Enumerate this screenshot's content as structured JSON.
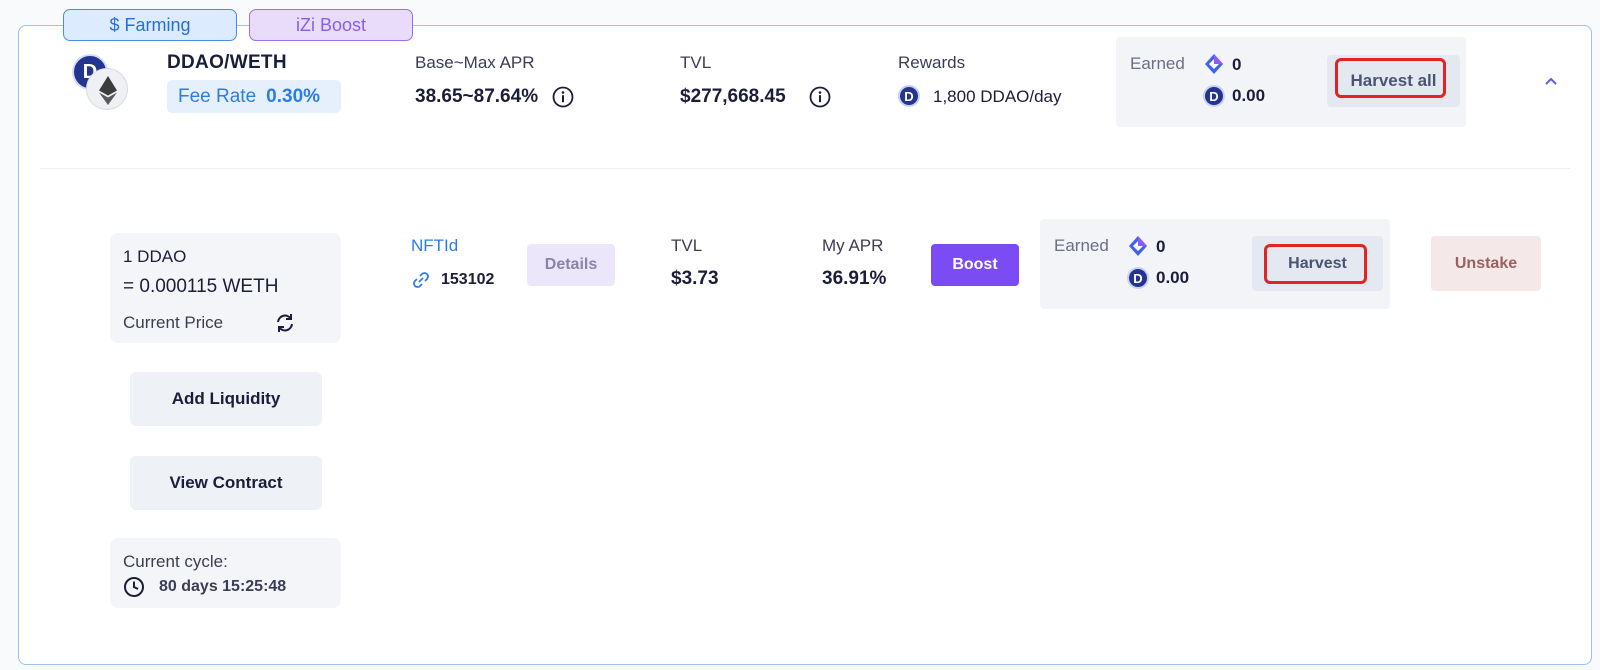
{
  "tags": {
    "farming": "$ Farming",
    "boost": "iZi Boost"
  },
  "pool": {
    "pair": "DDAO/WETH",
    "fee_rate_label": "Fee Rate",
    "fee_rate_value": "0.30%",
    "apr_label": "Base~Max APR",
    "apr_value": "38.65~87.64%",
    "tvl_label": "TVL",
    "tvl_value": "$277,668.45",
    "rewards_label": "Rewards",
    "rewards_value": "1,800 DDAO/day",
    "earned_label": "Earned",
    "earned_izi": "0",
    "earned_ddao": "0.00",
    "harvest_all_label": "Harvest all"
  },
  "sidebar": {
    "price_line1": "1 DDAO",
    "price_line2": "= 0.000115 WETH",
    "price_caption": "Current Price",
    "add_liquidity_label": "Add Liquidity",
    "view_contract_label": "View Contract",
    "cycle_label": "Current cycle:",
    "cycle_value": "80 days 15:25:48"
  },
  "position": {
    "nft_label": "NFTId",
    "nft_id": "153102",
    "details_label": "Details",
    "tvl_label": "TVL",
    "tvl_value": "$3.73",
    "my_apr_label": "My APR",
    "my_apr_value": "36.91%",
    "boost_label": "Boost",
    "earned_label": "Earned",
    "earned_izi": "0",
    "earned_ddao": "0.00",
    "harvest_label": "Harvest",
    "unstake_label": "Unstake"
  },
  "colors": {
    "accent_blue": "#2a7de8",
    "boost_purple": "#7b4cf4",
    "highlight_red": "#e32222"
  }
}
